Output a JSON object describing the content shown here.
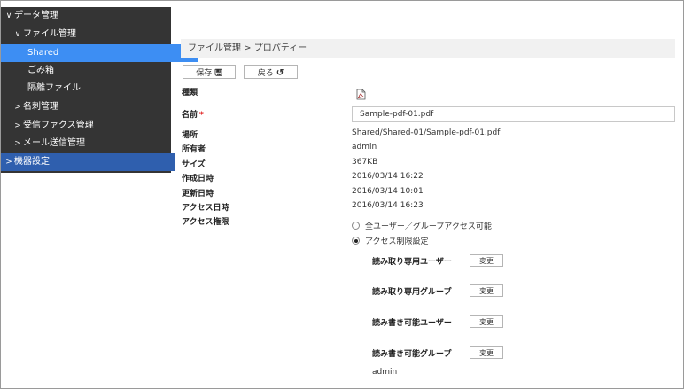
{
  "sidebar": {
    "items": [
      {
        "label": "データ管理",
        "chevron": "down"
      },
      {
        "label": "ファイル管理",
        "chevron": "down"
      },
      {
        "label": "Shared",
        "active": true
      },
      {
        "label": "ごみ箱"
      },
      {
        "label": "隔離ファイル"
      },
      {
        "label": "名刺管理",
        "chevron": "right"
      },
      {
        "label": "受信ファクス管理",
        "chevron": "right"
      },
      {
        "label": "メール送信管理",
        "chevron": "right"
      },
      {
        "label": "機器設定",
        "chevron": "right"
      }
    ],
    "colors": {
      "background": "#343434",
      "active": "#3d8ef3",
      "device": "#2f5fae"
    }
  },
  "breadcrumb": "ファイル管理 > プロパティー",
  "toolbar": {
    "save_label": "保存",
    "save_icon": "save-icon",
    "back_label": "戻る",
    "back_icon": "undo-icon"
  },
  "properties": {
    "type_label": "種類",
    "type_icon": "pdf-file-icon",
    "name_label": "名前",
    "name_required": "*",
    "name_value": "Sample-pdf-01.pdf",
    "location_label": "場所",
    "location_value": "Shared/Shared-01/Sample-pdf-01.pdf",
    "owner_label": "所有者",
    "owner_value": "admin",
    "size_label": "サイズ",
    "size_value": "367KB",
    "created_label": "作成日時",
    "created_value": "2016/03/14 16:22",
    "updated_label": "更新日時",
    "updated_value": "2016/03/14 10:01",
    "accessed_label": "アクセス日時",
    "accessed_value": "2016/03/14 16:23",
    "access_label": "アクセス権限"
  },
  "access": {
    "option_all": "全ユーザー／グループアクセス可能",
    "option_restricted": "アクセス制限設定",
    "selected": "restricted",
    "read_only_users": "読み取り専用ユーザー",
    "read_only_groups": "読み取り専用グループ",
    "writable_users": "読み書き可能ユーザー",
    "writable_groups": "読み書き可能グループ",
    "writable_groups_value": "admin",
    "change_label": "変更"
  }
}
